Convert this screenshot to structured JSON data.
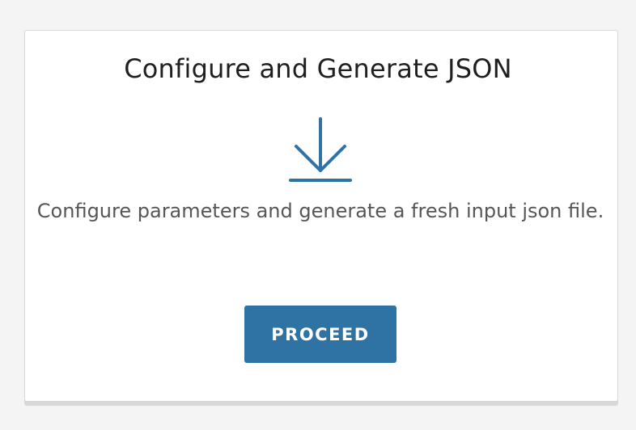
{
  "card": {
    "title": "Configure and Generate JSON",
    "icon": "download-icon",
    "description": "Configure parameters and generate a fresh input json file.",
    "button_label": "PROCEED"
  },
  "colors": {
    "accent": "#2f73a4",
    "title_text": "#1f1f1f",
    "body_text": "#565656",
    "card_background": "#ffffff",
    "page_background": "#f4f4f4"
  }
}
